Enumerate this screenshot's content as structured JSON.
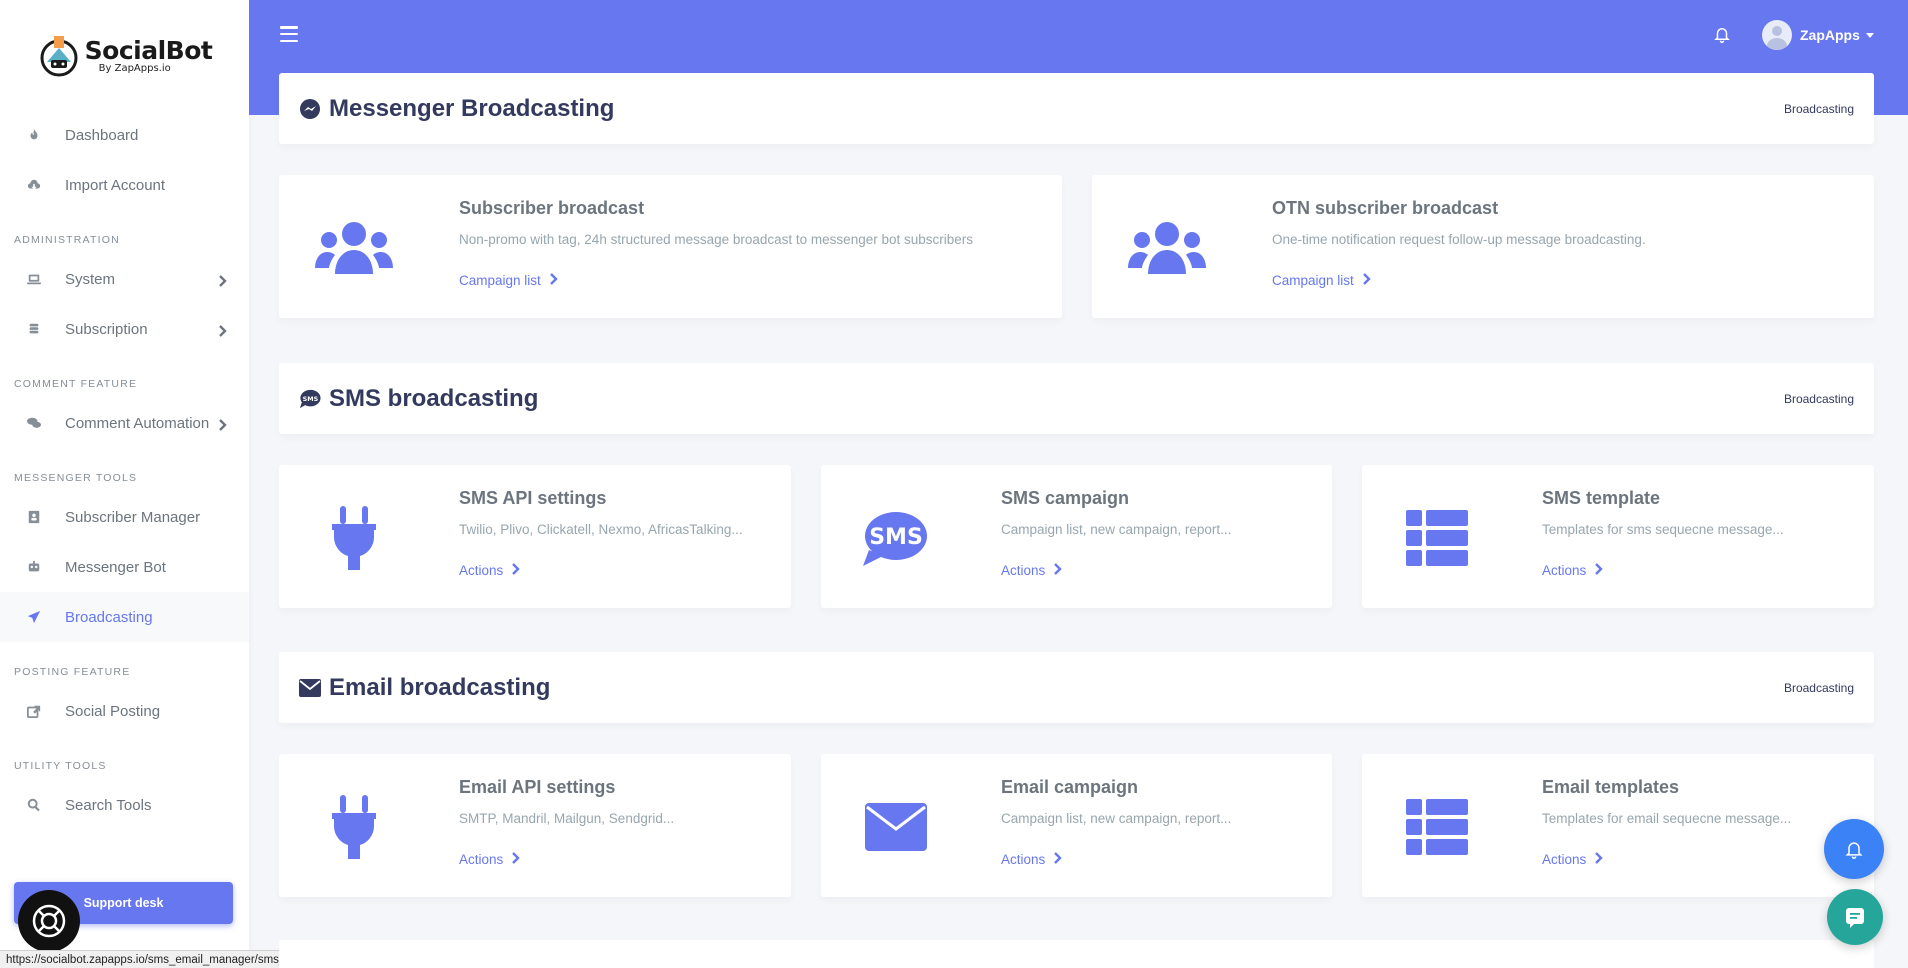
{
  "brand": {
    "name": "SocialBot",
    "sub": "By ZapApps.io"
  },
  "sidebar": {
    "items": [
      {
        "type": "item",
        "label": "Dashboard",
        "icon": "fire-icon"
      },
      {
        "type": "item",
        "label": "Import Account",
        "icon": "cloud-download-icon"
      },
      {
        "type": "header",
        "label": "ADMINISTRATION"
      },
      {
        "type": "item",
        "label": "System",
        "icon": "laptop-icon",
        "chevron": true
      },
      {
        "type": "item",
        "label": "Subscription",
        "icon": "coins-icon",
        "chevron": true
      },
      {
        "type": "header",
        "label": "COMMENT FEATURE"
      },
      {
        "type": "item",
        "label": "Comment Automation",
        "icon": "comments-icon",
        "chevron": true
      },
      {
        "type": "header",
        "label": "MESSENGER TOOLS"
      },
      {
        "type": "item",
        "label": "Subscriber Manager",
        "icon": "address-card-icon"
      },
      {
        "type": "item",
        "label": "Messenger Bot",
        "icon": "robot-icon"
      },
      {
        "type": "item",
        "label": "Broadcasting",
        "icon": "paper-plane-icon",
        "active": true
      },
      {
        "type": "header",
        "label": "POSTING FEATURE"
      },
      {
        "type": "item",
        "label": "Social Posting",
        "icon": "share-icon"
      },
      {
        "type": "header",
        "label": "UTILITY TOOLS"
      },
      {
        "type": "item",
        "label": "Search Tools",
        "icon": "search-icon"
      }
    ],
    "support_label": "Support desk"
  },
  "topbar": {
    "user_name": "ZapApps"
  },
  "sections": [
    {
      "title": "Messenger Broadcasting",
      "crumb": "Broadcasting",
      "icon": "messenger-icon",
      "cards": [
        {
          "title": "Subscriber broadcast",
          "desc": "Non-promo with tag, 24h structured message broadcast to messenger bot subscribers",
          "link": "Campaign list",
          "icon": "users-icon"
        },
        {
          "title": "OTN subscriber broadcast",
          "desc": "One-time notification request follow-up message broadcasting.",
          "link": "Campaign list",
          "icon": "users-icon"
        }
      ]
    },
    {
      "title": "SMS broadcasting",
      "crumb": "Broadcasting",
      "icon": "sms-icon",
      "cards": [
        {
          "title": "SMS API settings",
          "desc": "Twilio, Plivo, Clickatell, Nexmo, AfricasTalking...",
          "link": "Actions",
          "icon": "plug-icon"
        },
        {
          "title": "SMS campaign",
          "desc": "Campaign list, new campaign, report...",
          "link": "Actions",
          "icon": "sms-icon"
        },
        {
          "title": "SMS template",
          "desc": "Templates for sms sequecne message...",
          "link": "Actions",
          "icon": "th-list-icon"
        }
      ]
    },
    {
      "title": "Email broadcasting",
      "crumb": "Broadcasting",
      "icon": "envelope-icon",
      "cards": [
        {
          "title": "Email API settings",
          "desc": "SMTP, Mandril, Mailgun, Sendgrid...",
          "link": "Actions",
          "icon": "plug-icon"
        },
        {
          "title": "Email campaign",
          "desc": "Campaign list, new campaign, report...",
          "link": "Actions",
          "icon": "envelope-icon"
        },
        {
          "title": "Email templates",
          "desc": "Templates for email sequecne message...",
          "link": "Actions",
          "icon": "th-list-icon"
        }
      ]
    }
  ],
  "statusbar": {
    "url": "https://socialbot.zapapps.io/sms_email_manager/sms_api_lists"
  },
  "colors": {
    "primary": "#6777ef",
    "fab_bell": "#3b82f6",
    "fab_chat": "#26a69a"
  }
}
